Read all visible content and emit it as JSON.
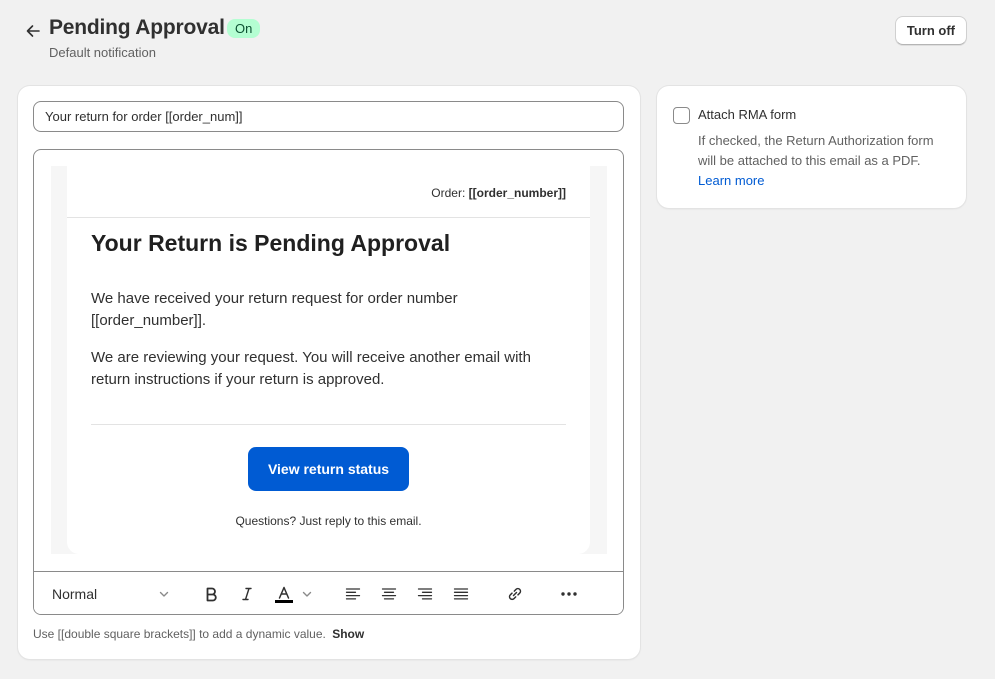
{
  "header": {
    "title": "Pending Approval",
    "status_badge": "On",
    "subtitle": "Default notification",
    "turn_off_label": "Turn off"
  },
  "editor": {
    "subject_value": "Your return for order [[order_num]]",
    "preview": {
      "order_prefix": "Order:",
      "order_token": "[[order_number]]",
      "heading": "Your Return is Pending Approval",
      "paragraph1": "We have received your return request for order number [[order_number]].",
      "paragraph2": "We are reviewing your request. You will receive another email with return instructions if your return is approved.",
      "cta_label": "View return status",
      "footer": "Questions? Just reply to this email."
    },
    "toolbar": {
      "format_value": "Normal",
      "tools": [
        "bold-icon",
        "italic-icon",
        "text-color-icon",
        "align-left-icon",
        "align-center-icon",
        "align-right-icon",
        "align-justify-icon",
        "link-icon",
        "more-icon"
      ]
    },
    "help_text": "Use [[double square brackets]] to add a dynamic value.",
    "help_show": "Show"
  },
  "sidebar": {
    "checkbox_label": "Attach RMA form",
    "checkbox_checked": false,
    "checkbox_help": "If checked, the Return Authorization form will be attached to this email as a PDF.",
    "learn_more": "Learn more"
  },
  "colors": {
    "accent": "#005bd3",
    "badge_bg": "#b4fed2",
    "badge_text": "#0c5132"
  }
}
